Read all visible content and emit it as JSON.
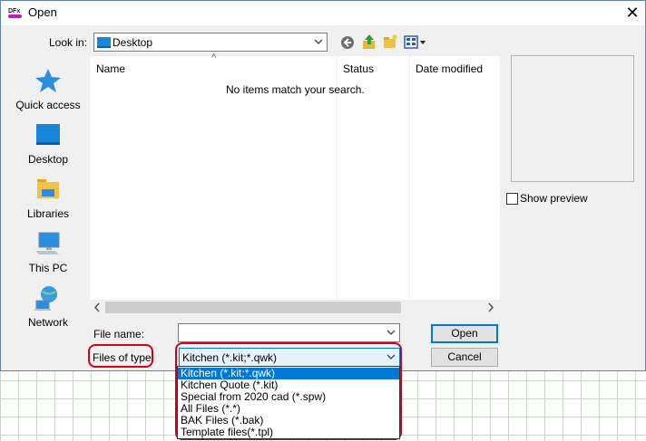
{
  "window": {
    "title": "Open",
    "app_icon": "dfx-app-icon",
    "close_glyph": "✕"
  },
  "look_in": {
    "label": "Look in:",
    "value": "Desktop",
    "toolbar_icons": [
      "back-icon",
      "up-folder-icon",
      "new-folder-icon",
      "view-menu-icon"
    ]
  },
  "places": [
    {
      "label": "Quick access",
      "icon": "star-icon"
    },
    {
      "label": "Desktop",
      "icon": "desktop-icon"
    },
    {
      "label": "Libraries",
      "icon": "libraries-icon"
    },
    {
      "label": "This PC",
      "icon": "computer-icon"
    },
    {
      "label": "Network",
      "icon": "network-icon"
    }
  ],
  "file_list": {
    "columns": [
      "Name",
      "Status",
      "Date modified"
    ],
    "sort_indicator": "^",
    "empty_message": "No items match your search."
  },
  "preview": {
    "show_preview_label": "Show preview",
    "checked": false
  },
  "file_name": {
    "label": "File name:",
    "value": ""
  },
  "files_of_type": {
    "label": "Files of type:",
    "selected": "Kitchen (*.kit;*.qwk)",
    "options": [
      "Kitchen (*.kit;*.qwk)",
      "Kitchen Quote (*.kit)",
      "Special from 2020 cad (*.spw)",
      "All Files (*.*)",
      "BAK Files (*.bak)",
      "Template files(*.tpl)"
    ]
  },
  "buttons": {
    "open": "Open",
    "cancel": "Cancel"
  },
  "colors": {
    "highlight": "#0078d7",
    "annotation_ring": "#d0021b",
    "window_border": "#5b82b5"
  }
}
